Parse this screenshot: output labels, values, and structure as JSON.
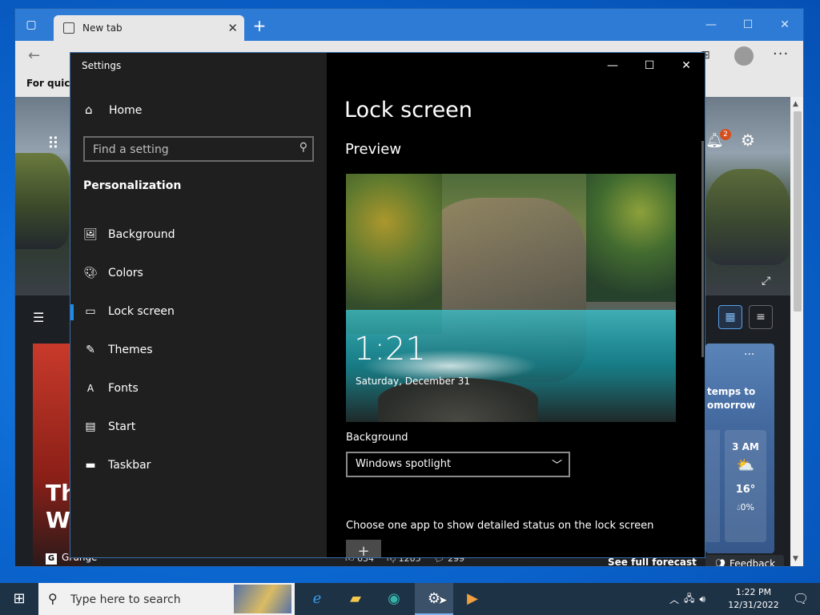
{
  "edge": {
    "tab_title": "New tab",
    "tab_close": "✕",
    "new_tab": "+",
    "favorites_text": "For quick a",
    "more": "···",
    "news": {
      "badge": "2",
      "card_title": "Th\nWa",
      "source": "Grunge",
      "reactions": {
        "likes": "634",
        "dislikes": "1205",
        "comments": "299"
      },
      "weather_note": "temps to\nomorrow",
      "weather_hour": {
        "time": "3 AM",
        "temp": "16°",
        "precip": "0%"
      },
      "forecast_link": "See full forecast",
      "feedback": "Feedback"
    }
  },
  "settings": {
    "title": "Settings",
    "home": "Home",
    "search_placeholder": "Find a setting",
    "section": "Personalization",
    "nav": [
      {
        "label": "Background",
        "icon": "image-icon"
      },
      {
        "label": "Colors",
        "icon": "palette-icon"
      },
      {
        "label": "Lock screen",
        "icon": "lock-screen-icon"
      },
      {
        "label": "Themes",
        "icon": "themes-icon"
      },
      {
        "label": "Fonts",
        "icon": "fonts-icon"
      },
      {
        "label": "Start",
        "icon": "start-icon"
      },
      {
        "label": "Taskbar",
        "icon": "taskbar-icon"
      }
    ],
    "active_nav": "Lock screen",
    "page_title": "Lock screen",
    "preview_heading": "Preview",
    "lock_time": "1:21",
    "lock_date": "Saturday, December 31",
    "background_label": "Background",
    "background_value": "Windows spotlight",
    "detail_label": "Choose one app to show detailed status on the lock screen",
    "app_tile": "+"
  },
  "taskbar": {
    "search_placeholder": "Type here to search",
    "time": "1:22 PM",
    "date": "12/31/2022"
  },
  "colors": {
    "accent": "#1d8ae8",
    "settings_sidebar": "#1f1f1f",
    "settings_main": "#000000",
    "taskbar": "#1e3246"
  }
}
